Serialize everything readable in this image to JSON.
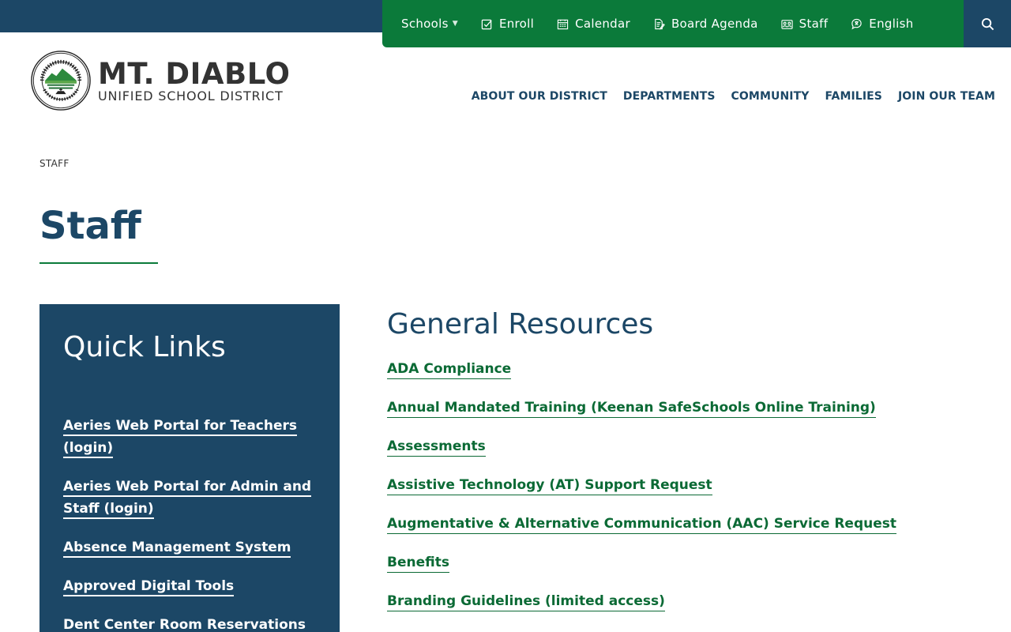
{
  "utility_nav": [
    {
      "label": "Schools",
      "icon": "caret-down-icon"
    },
    {
      "label": "Enroll",
      "icon": "checkbox-icon"
    },
    {
      "label": "Calendar",
      "icon": "calendar-icon"
    },
    {
      "label": "Board Agenda",
      "icon": "document-edit-icon"
    },
    {
      "label": "Staff",
      "icon": "staff-icon"
    },
    {
      "label": "English",
      "icon": "translate-icon"
    }
  ],
  "logo": {
    "name": "MT. DIABLO",
    "subtitle": "UNIFIED SCHOOL DISTRICT",
    "seal_text": "MT. DIABLO UNIFIED SCHOOL DISTRICT"
  },
  "main_nav": [
    "ABOUT OUR DISTRICT",
    "DEPARTMENTS",
    "COMMUNITY",
    "FAMILIES",
    "JOIN OUR TEAM"
  ],
  "breadcrumb": "STAFF",
  "page_title": "Staff",
  "quick_links": {
    "title": "Quick Links",
    "items": [
      "Aeries Web Portal for Teachers (login)",
      "Aeries Web Portal for Admin and Staff (login)",
      "Absence Management System",
      "Approved Digital Tools",
      "Dent Center Room Reservations"
    ]
  },
  "general_resources": {
    "title": "General Resources",
    "items": [
      "ADA Compliance",
      "Annual Mandated Training (Keenan SafeSchools Online Training)",
      "Assessments",
      "Assistive Technology (AT) Support Request",
      "Augmentative & Alternative Communication (AAC) Service Request",
      "Benefits",
      "Branding Guidelines (limited access)"
    ]
  },
  "colors": {
    "navy": "#1c4766",
    "green": "#0b7a3a",
    "link_green": "#0b6a35"
  }
}
